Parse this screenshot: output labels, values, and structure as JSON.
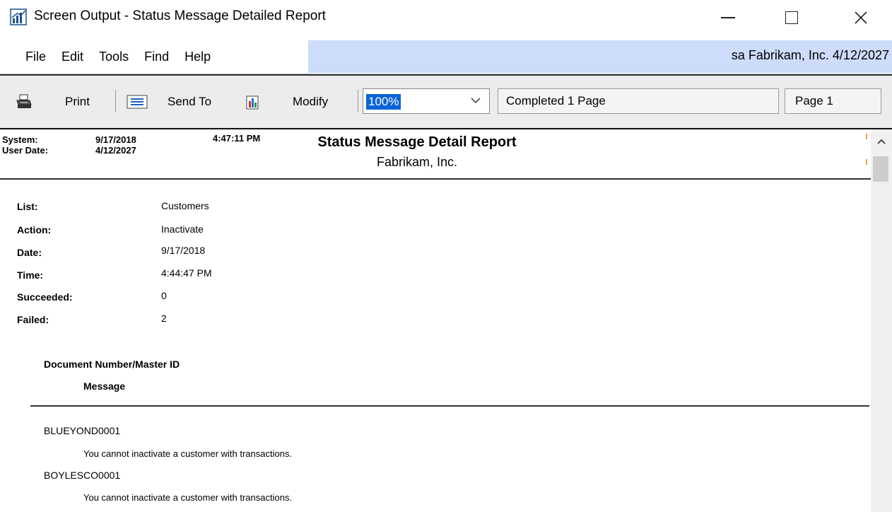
{
  "window": {
    "title": "Screen Output - Status Message Detailed Report"
  },
  "menu": {
    "items": [
      "File",
      "Edit",
      "Tools",
      "Find",
      "Help"
    ],
    "user_info": "sa  Fabrikam, Inc.  4/12/2027"
  },
  "toolbar": {
    "print_label": "Print",
    "send_to_label": "Send To",
    "modify_label": "Modify",
    "zoom_value": "100%",
    "status_text": "Completed 1 Page",
    "page_text": "Page 1"
  },
  "report": {
    "system_label": "System:",
    "system_date": "9/17/2018",
    "system_time": "4:47:11 PM",
    "user_date_label": "User Date:",
    "user_date": "4/12/2027",
    "title": "Status Message Detail Report",
    "company": "Fabrikam, Inc.",
    "fields": [
      {
        "label": "List:",
        "value": "Customers"
      },
      {
        "label": "Action:",
        "value": "Inactivate"
      },
      {
        "label": "Date:",
        "value": "9/17/2018"
      },
      {
        "label": "Time:",
        "value": "4:44:47 PM"
      },
      {
        "label": "Succeeded:",
        "value": "0"
      },
      {
        "label": "Failed:",
        "value": "2"
      }
    ],
    "column_header_1": "Document Number/Master ID",
    "column_header_2": "Message",
    "rows": [
      {
        "id": "BLUEYOND0001",
        "message": "You cannot inactivate a customer with transactions."
      },
      {
        "id": "BOYLESCO0001",
        "message": "You cannot inactivate a customer with transactions."
      }
    ]
  },
  "colors": {
    "menu_info_bg": "#cddcfa",
    "toolbar_bg": "#ececec",
    "zoom_highlight": "#0a64d8"
  },
  "icons": {
    "app": "bar-chart-app-icon",
    "print": "printer-icon",
    "send_to": "send-to-icon",
    "modify": "modify-icon",
    "dropdown": "chevron-down-icon",
    "scroll_up": "chevron-up-icon"
  }
}
